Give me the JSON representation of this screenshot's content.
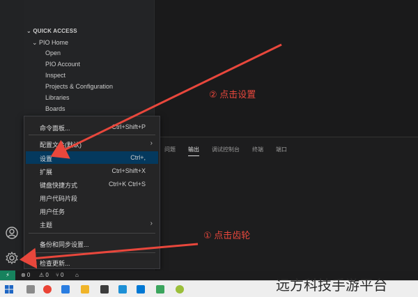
{
  "sidebar": {
    "section_title": "QUICK ACCESS",
    "group_label": "PIO Home",
    "items": [
      "Open",
      "PIO Account",
      "Inspect",
      "Projects & Configuration",
      "Libraries",
      "Boards"
    ]
  },
  "panel": {
    "tabs": [
      "问题",
      "输出",
      "调试控制台",
      "终端",
      "端口"
    ],
    "active_tab": "输出"
  },
  "context_menu": {
    "items": [
      {
        "label": "命令面板...",
        "shortcut": "Ctrl+Shift+P"
      },
      {
        "label": "配置文件(默认)",
        "shortcut": ""
      },
      {
        "label": "设置",
        "shortcut": "Ctrl+,"
      },
      {
        "label": "扩展",
        "shortcut": "Ctrl+Shift+X"
      },
      {
        "label": "键盘快捷方式",
        "shortcut": "Ctrl+K Ctrl+S"
      },
      {
        "label": "用户代码片段",
        "shortcut": ""
      },
      {
        "label": "用户任务",
        "shortcut": ""
      },
      {
        "label": "主题",
        "shortcut": ""
      },
      {
        "label": "备份和同步设置...",
        "shortcut": ""
      },
      {
        "label": "检查更新...",
        "shortcut": ""
      }
    ],
    "selected": "设置",
    "submenu_arrow": "›"
  },
  "statusbar": {
    "remote_icon": "⚡",
    "errors": "⊗ 0",
    "warnings": "⚠ 0",
    "ports": "⑂ 0",
    "home_icon": "⌂"
  },
  "annotations": {
    "step1": "① 点击齿轮",
    "step2": "② 点击设置",
    "arrow_color": "#e8473c"
  },
  "watermark": "远方科技手游平台",
  "colors": {
    "selection": "#04395e",
    "remote": "#16825d"
  }
}
